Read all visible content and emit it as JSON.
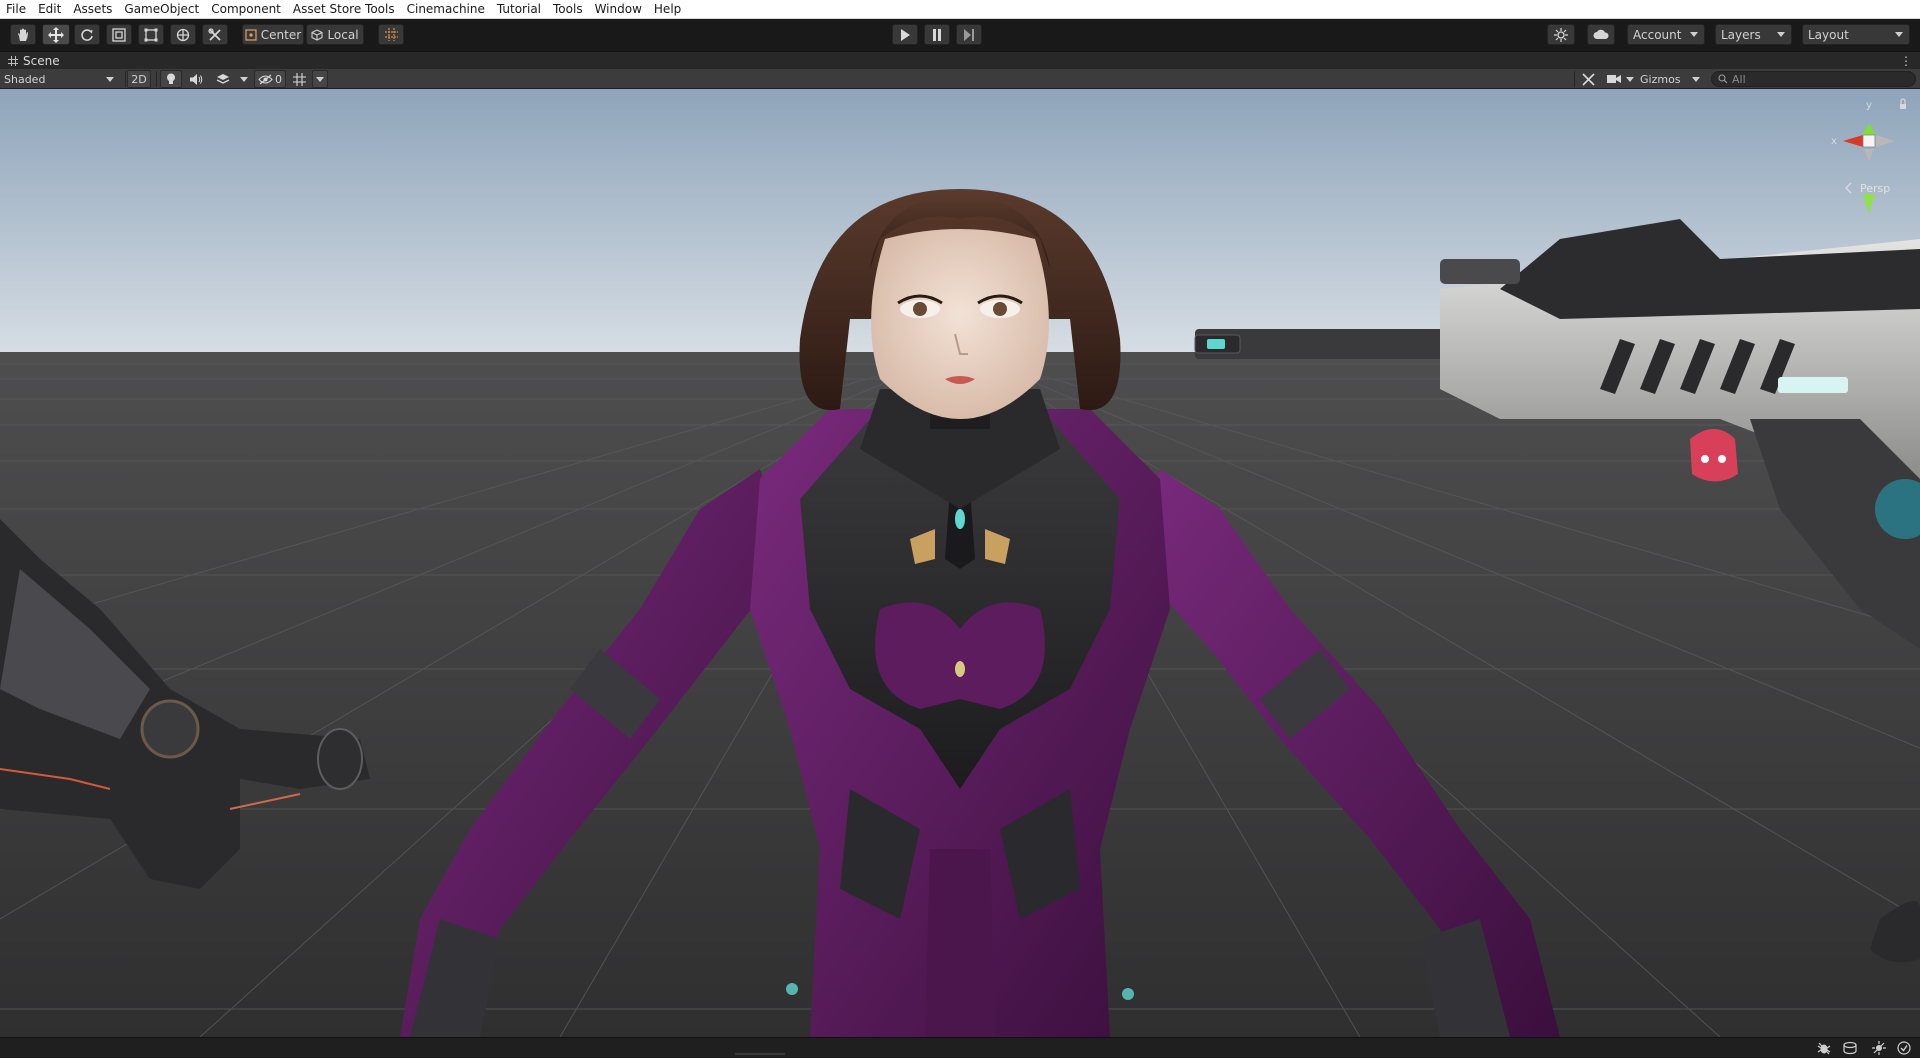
{
  "menubar": {
    "items": [
      {
        "label": "File"
      },
      {
        "label": "Edit"
      },
      {
        "label": "Assets"
      },
      {
        "label": "GameObject"
      },
      {
        "label": "Component"
      },
      {
        "label": "Asset Store Tools"
      },
      {
        "label": "Cinemachine"
      },
      {
        "label": "Tutorial"
      },
      {
        "label": "Tools"
      },
      {
        "label": "Window"
      },
      {
        "label": "Help"
      }
    ]
  },
  "toolbar": {
    "tools": [
      "hand-tool-icon",
      "move-tool-icon",
      "rotate-tool-icon",
      "scale-tool-icon",
      "rect-tool-icon",
      "transform-tool-icon",
      "custom-tool-icon"
    ],
    "pivot_label": "Center",
    "space_label": "Local",
    "account_label": "Account",
    "layers_label": "Layers",
    "layout_label": "Layout"
  },
  "scene_tab": {
    "label": "Scene"
  },
  "scene_toolbar": {
    "shading_mode": "Shaded",
    "mode_2d": "2D",
    "hidden_count": "0",
    "gizmos_label": "Gizmos",
    "search_placeholder": "All"
  },
  "orientation_gizmo": {
    "y_label": "y",
    "x_label": "x",
    "projection_label": "Persp"
  },
  "colors": {
    "sky_top": "#8ea4ba",
    "sky_bottom": "#d6dde4",
    "ground": "#3e3e3e",
    "suit_purple": "#5a1a5c",
    "accent_cyan": "#5fd6d0"
  }
}
